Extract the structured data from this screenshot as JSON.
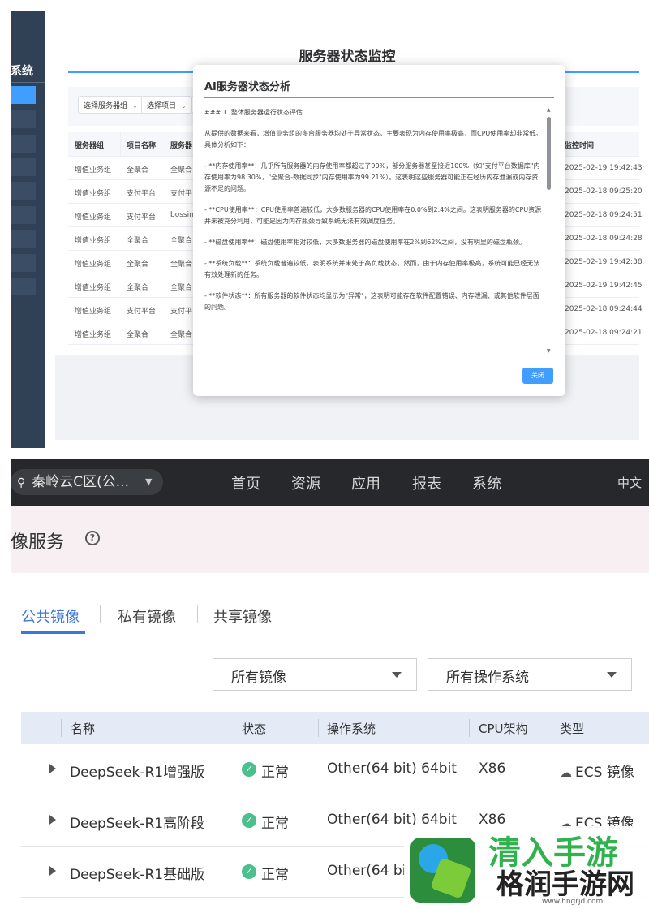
{
  "monitor": {
    "sidebar_title": "系统",
    "page_title": "服务器状态监控",
    "filters": {
      "server_group": "选择服务器组",
      "project": "选择项目",
      "third": "选"
    },
    "columns": [
      "服务器组",
      "项目名称",
      "服务器",
      "监控时间"
    ],
    "rows": [
      {
        "group": "增值业务组",
        "project": "全聚合",
        "server": "全聚合",
        "time": "2025-02-19 19:42:43"
      },
      {
        "group": "增值业务组",
        "project": "支付平台",
        "server": "支付平",
        "time": "2025-02-18 09:25:20"
      },
      {
        "group": "增值业务组",
        "project": "支付平台",
        "server": "bossin",
        "time": "2025-02-18 09:24:51"
      },
      {
        "group": "增值业务组",
        "project": "全聚合",
        "server": "全聚合",
        "time": "2025-02-18 09:24:28"
      },
      {
        "group": "增值业务组",
        "project": "全聚合",
        "server": "全聚合",
        "time": "2025-02-19 19:42:38"
      },
      {
        "group": "增值业务组",
        "project": "全聚合",
        "server": "全聚合",
        "time": "2025-02-19 19:42:45"
      },
      {
        "group": "增值业务组",
        "project": "支付平台",
        "server": "支付平",
        "time": "2025-02-18 09:24:44"
      },
      {
        "group": "增值业务组",
        "project": "全聚合",
        "server": "全聚合",
        "time": "2025-02-18 09:24:21"
      }
    ],
    "modal": {
      "title": "AI服务器状态分析",
      "paragraphs": [
        "### 1. 整体服务器运行状态评估",
        "从提供的数据来看，增值业务组的多台服务器均处于异常状态，主要表现为内存使用率极高，而CPU使用率却非常低。具体分析如下：",
        "- **内存使用率**：几乎所有服务器的内存使用率都超过了90%，部分服务器甚至接近100%（如\"支付平台数据库\"内存使用率为98.30%，\"全聚合-数据同步\"内存使用率为99.21%）。这表明这些服务器可能正在经历内存泄漏或内存资源不足的问题。",
        "- **CPU使用率**：CPU使用率普遍较低，大多数服务器的CPU使用率在0.0%到2.4%之间。这表明服务器的CPU资源并未被充分利用，可能是因为内存瓶颈导致系统无法有效调度任务。",
        "- **磁盘使用率**：磁盘使用率相对较低，大多数服务器的磁盘使用率在2%到62%之间，没有明显的磁盘瓶颈。",
        "- **系统负载**：系统负载普遍较低，表明系统并未处于高负载状态。然而，由于内存使用率极高，系统可能已经无法有效处理新的任务。",
        "- **软件状态**：所有服务器的软件状态均显示为\"异常\"，这表明可能存在软件配置错误、内存泄漏、或其他软件层面的问题。"
      ],
      "close_label": "关闭"
    }
  },
  "cloud": {
    "region": "秦岭云C区(公...",
    "nav": [
      "首页",
      "资源",
      "应用",
      "报表",
      "系统"
    ],
    "lang": "中文",
    "page_title": "像服务",
    "tabs": [
      "公共镜像",
      "私有镜像",
      "共享镜像"
    ],
    "dropdowns": {
      "image": "所有镜像",
      "os": "所有操作系统"
    },
    "columns": {
      "name": "名称",
      "status": "状态",
      "os": "操作系统",
      "cpu": "CPU架构",
      "type": "类型"
    },
    "rows": [
      {
        "name": "DeepSeek-R1增强版",
        "status": "正常",
        "os": "Other(64 bit) 64bit",
        "cpu": "X86",
        "type": "ECS 镜像"
      },
      {
        "name": "DeepSeek-R1高阶段",
        "status": "正常",
        "os": "Other(64 bit) 64bit",
        "cpu": "X86",
        "type": "ECS 镜像"
      },
      {
        "name": "DeepSeek-R1基础版",
        "status": "正常",
        "os": "Other(64 bi",
        "cpu": "",
        "type": ""
      }
    ]
  },
  "watermark": {
    "top": "清入手游",
    "name": "格润手游网",
    "url": "www.hngrjd.com"
  },
  "colors": {
    "accent": "#409eff",
    "sidebar": "#304156",
    "nav_bg": "#26282b",
    "tab_active": "#3a77d6",
    "ok": "#4cbf8e"
  }
}
